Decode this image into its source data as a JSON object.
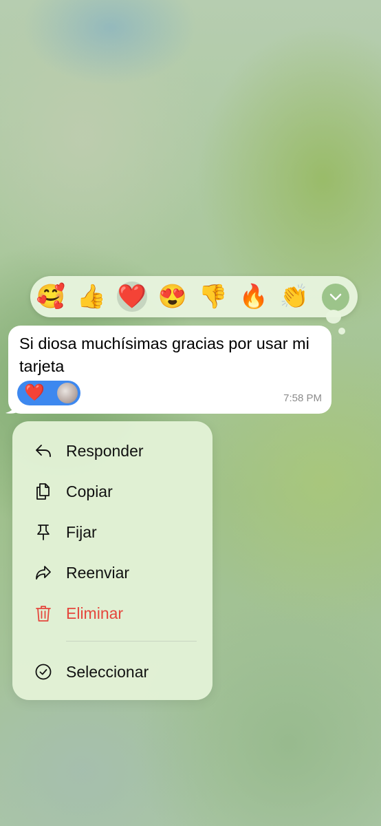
{
  "reaction_bar": {
    "emojis": [
      "🥰",
      "👍",
      "❤️",
      "😍",
      "👎",
      "🔥",
      "👏"
    ],
    "selected_index": 2,
    "expand_icon": "chevron-down-icon"
  },
  "message": {
    "text": "Si diosa muchísimas gracias por usar mi tarjeta",
    "time": "7:58 PM",
    "reaction": "❤️"
  },
  "menu": {
    "items": [
      {
        "label": "Responder",
        "icon": "reply-icon"
      },
      {
        "label": "Copiar",
        "icon": "copy-icon"
      },
      {
        "label": "Fijar",
        "icon": "pin-icon"
      },
      {
        "label": "Reenviar",
        "icon": "forward-icon"
      },
      {
        "label": "Eliminar",
        "icon": "trash-icon",
        "destructive": true
      },
      {
        "label": "Seleccionar",
        "icon": "check-circle-icon"
      }
    ]
  },
  "colors": {
    "accent": "#3d88ef",
    "destructive": "#e5463c",
    "expand_button": "#9cc48a"
  }
}
